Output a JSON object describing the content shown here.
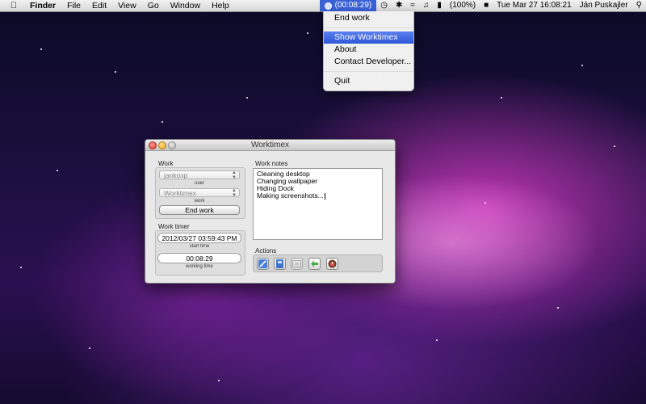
{
  "menubar": {
    "apple_icon": "apple-icon",
    "items": [
      "Finder",
      "File",
      "Edit",
      "View",
      "Go",
      "Window",
      "Help"
    ],
    "status": {
      "timer": "(00:08:29)",
      "battery": "(100%)",
      "datetime": "Tue Mar 27  16:08:21",
      "user": "Ján Puskajler"
    }
  },
  "dropdown": {
    "items": [
      "End work",
      "Show Worktimex",
      "About",
      "Contact Developer...",
      "Quit"
    ],
    "selected": "Show Worktimex"
  },
  "window": {
    "title": "Worktimex",
    "work_section": {
      "label": "Work",
      "user_value": "jankoxp",
      "user_caption": "user",
      "work_value": "Worktimex",
      "work_caption": "work",
      "end_button": "End work"
    },
    "timer_section": {
      "label": "Work timer",
      "start_time": "2012/03/27 03:59:43 PM",
      "start_caption": "start time",
      "working_time": "00:08:29",
      "working_caption": "working time"
    },
    "notes_section": {
      "label": "Work notes",
      "lines": [
        "Cleaning desktop",
        "Changing wallpaper",
        "Hiding Dock",
        "Making screenshots..."
      ]
    },
    "actions_section": {
      "label": "Actions",
      "buttons": [
        "pencil-icon",
        "notebook-icon",
        "image-icon",
        "green-arrow-icon",
        "stopwatch-icon"
      ]
    }
  },
  "colors": {
    "selection": "#2f58d8",
    "desktop": "#c23ab8"
  }
}
